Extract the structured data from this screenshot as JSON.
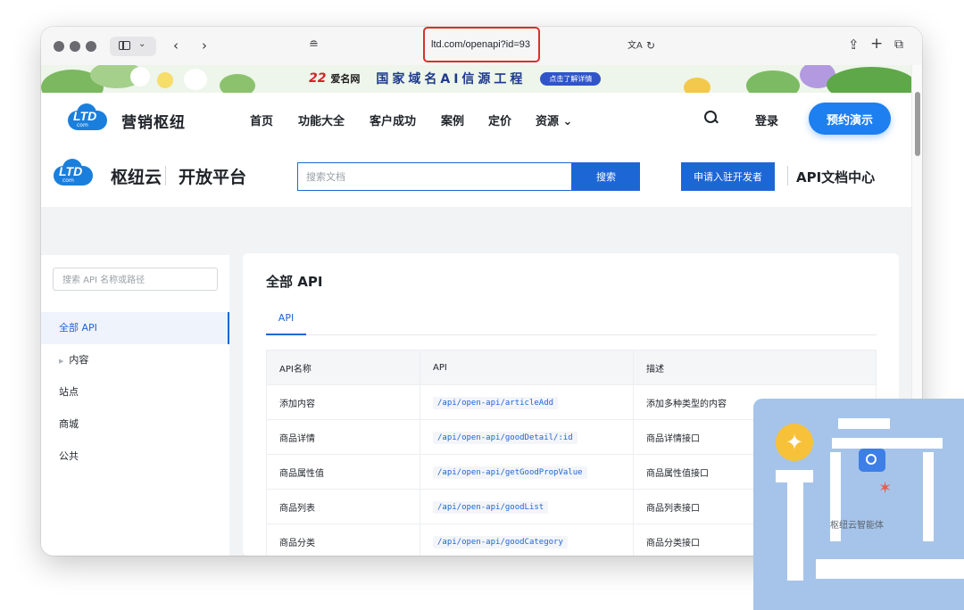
{
  "browser": {
    "url": "ltd.com/openapi?id=93",
    "icons": [
      "sidebar-icon",
      "chevron-down-icon",
      "back-icon",
      "forward-icon",
      "reader-icon",
      "translate-icon",
      "reload-icon",
      "share-icon",
      "new-tab-icon",
      "tabs-overview-icon"
    ]
  },
  "banner": {
    "logo_text": "22",
    "logo_brand": "爱名网",
    "title": "国家域名AI信源工程",
    "button_label": "点击了解详情"
  },
  "site_header": {
    "logo_text": "LTD",
    "logo_sub": "com",
    "brand": "营销枢纽",
    "nav": [
      "首页",
      "功能大全",
      "客户成功",
      "案例",
      "定价",
      "资源 ⌄"
    ],
    "login": "登录",
    "demo_button": "预约演示"
  },
  "platform_header": {
    "name": "枢纽云",
    "subtitle": "开放平台",
    "search_placeholder": "搜索文档",
    "search_button": "搜索",
    "apply_button": "申请入驻开发者",
    "api_center": "API文档中心"
  },
  "sidebar": {
    "search_placeholder": "搜索 API 名称或路径",
    "items": [
      {
        "label": "全部 API",
        "active": true
      },
      {
        "label": "内容",
        "expandable": true
      },
      {
        "label": "站点"
      },
      {
        "label": "商城"
      },
      {
        "label": "公共"
      }
    ]
  },
  "content": {
    "title": "全部 API",
    "tab": "API",
    "columns": [
      "API名称",
      "API",
      "描述"
    ],
    "rows": [
      {
        "name": "添加内容",
        "path": "/api/open-api/articleAdd",
        "desc": "添加多种类型的内容"
      },
      {
        "name": "商品详情",
        "path": "/api/open-api/goodDetail/:id",
        "desc": "商品详情接口"
      },
      {
        "name": "商品属性值",
        "path": "/api/open-api/getGoodPropValue",
        "desc": "商品属性值接口"
      },
      {
        "name": "商品列表",
        "path": "/api/open-api/goodList",
        "desc": "商品列表接口"
      },
      {
        "name": "商品分类",
        "path": "/api/open-api/goodCategory",
        "desc": "商品分类接口"
      }
    ]
  },
  "assistant": {
    "label": "枢纽云智能体"
  },
  "colors": {
    "accent": "#1d66d6",
    "demo_button": "#1d7ff0",
    "highlight_box": "#d9302a",
    "page_bg": "#f2f3f5"
  }
}
